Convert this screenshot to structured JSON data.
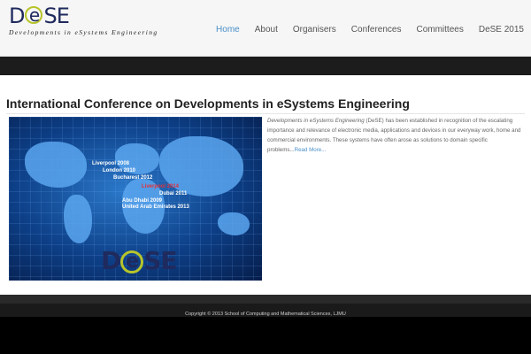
{
  "logo": {
    "text_before": "D",
    "text_e": "e",
    "text_after": "SE",
    "tagline": "Developments in eSystems Engineering"
  },
  "nav": {
    "items": [
      {
        "label": "Home",
        "active": true
      },
      {
        "label": "About"
      },
      {
        "label": "Organisers"
      },
      {
        "label": "Conferences"
      },
      {
        "label": "Committees"
      },
      {
        "label": "DeSE 2015"
      }
    ]
  },
  "main": {
    "title": "International Conference on Developments in eSystems Engineering",
    "description_italic": "Developments in eSystems Engineering",
    "description_rest": " (DeSE) has been established in recognition of the escalating importance and relevance of electronic media, applications and devices in our everyway work, home and commercial environments. These systems have often arose as solutions to domain specific problems...",
    "read_more": "Read More..."
  },
  "map_labels": [
    {
      "text": "Liverpool 2008"
    },
    {
      "text": "London 2010"
    },
    {
      "text": "Bucharest 2012"
    },
    {
      "text": "Liverpool 2014"
    },
    {
      "text": "Dubai 2011"
    },
    {
      "text": "Abu Dhabi 2009"
    },
    {
      "text": "United Arab Emirates 2013"
    }
  ],
  "map_logo": {
    "before": "D",
    "e": "e",
    "after": "SE"
  },
  "footer": {
    "copyright": "Copyright © 2013 School of Computing and Mathematical Sciences, LJMU"
  },
  "colors": {
    "accent": "#4a8fc8",
    "logo_ring": "#b7c42b",
    "logo_text": "#1f2a5e"
  }
}
